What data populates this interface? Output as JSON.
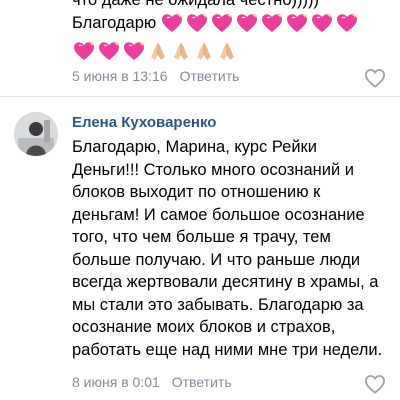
{
  "comment1": {
    "text_lines": [
      "что даже не ожидала честно)))))",
      "Благодарю"
    ],
    "emoji_hearts_count": 11,
    "emoji_pray_count": 4,
    "emoji_icons": [
      "sparkling-heart-icon",
      "folded-hands-icon"
    ],
    "date": "5 июня в 13:16",
    "reply_label": "Ответить"
  },
  "comment2": {
    "author": "Елена Куховаренко",
    "text": "Благодарю, Марина, курс Рейки Деньги!!! Столько много осознаний и блоков выходит по отношению к деньгам! И самое большое осознание того, что чем больше я трачу, тем больше получаю. И что раньше люди всегда жертвовали десятину в храмы, а мы стали это забывать. Благодарю за осознание моих блоков и страхов, работать еще над ними мне три недели.",
    "date": "8 июня в 0:01",
    "reply_label": "Ответить"
  },
  "colors": {
    "author": "#2a5885",
    "meta": "#818c99",
    "divider": "#e3e4e8",
    "heart": "#e8409a"
  }
}
